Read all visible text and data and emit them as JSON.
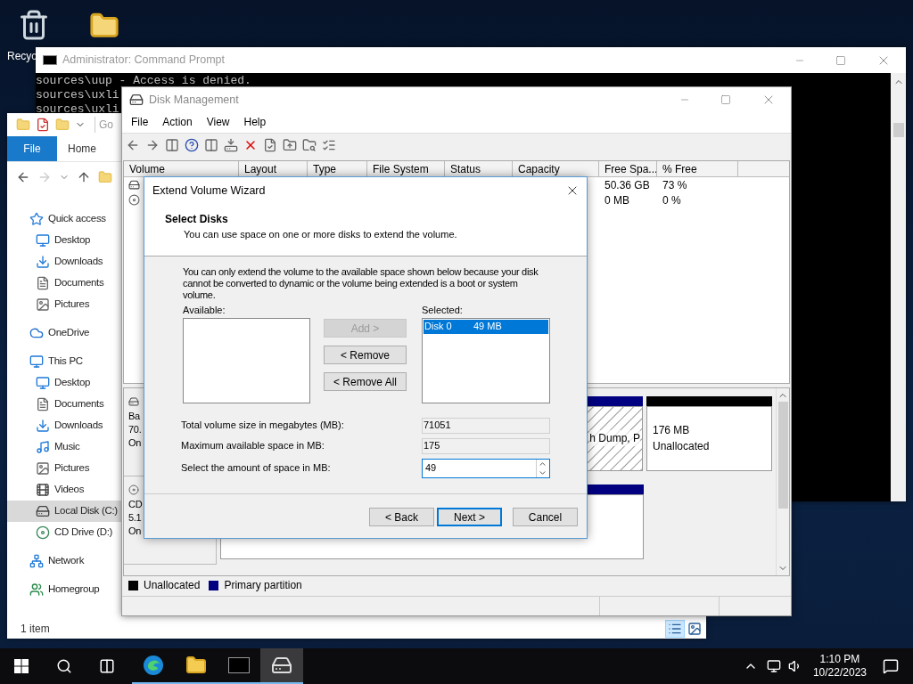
{
  "desktop": {
    "icons": [
      {
        "kind": "recycle",
        "label": "Recyc"
      },
      {
        "kind": "folder"
      }
    ]
  },
  "cmd": {
    "title": "Administrator: Command Prompt",
    "lines": [
      "sources\\uup - Access is denied.",
      "sources\\uxli",
      "sources\\uxli"
    ]
  },
  "explorer": {
    "title_fragment": "Go",
    "ribbon_tabs": [
      {
        "label": "File",
        "selected": true
      },
      {
        "label": "Home",
        "selected": false
      }
    ],
    "nav": [
      {
        "label": "Quick access",
        "kind": "star",
        "selected": false,
        "children": [
          {
            "label": "Desktop",
            "kind": "desktop",
            "selected": false
          },
          {
            "label": "Downloads",
            "kind": "download",
            "selected": false
          },
          {
            "label": "Documents",
            "kind": "document",
            "selected": false
          },
          {
            "label": "Pictures",
            "kind": "picture",
            "selected": false
          }
        ]
      },
      {
        "label": "OneDrive",
        "kind": "cloud",
        "selected": false
      },
      {
        "label": "This PC",
        "kind": "pc",
        "selected": false,
        "children": [
          {
            "label": "Desktop",
            "kind": "desktop",
            "selected": false
          },
          {
            "label": "Documents",
            "kind": "document",
            "selected": false
          },
          {
            "label": "Downloads",
            "kind": "download",
            "selected": false
          },
          {
            "label": "Music",
            "kind": "music",
            "selected": false
          },
          {
            "label": "Pictures",
            "kind": "picture",
            "selected": false
          },
          {
            "label": "Videos",
            "kind": "video",
            "selected": false
          },
          {
            "label": "Local Disk (C:)",
            "kind": "drive",
            "selected": true
          },
          {
            "label": "CD Drive (D:)",
            "kind": "cd",
            "selected": false
          }
        ]
      },
      {
        "label": "Network",
        "kind": "network",
        "selected": false
      },
      {
        "label": "Homegroup",
        "kind": "homegroup",
        "selected": false
      }
    ],
    "status": "1 item",
    "views": [
      {
        "kind": "details",
        "selected": true
      },
      {
        "kind": "thumbnails",
        "selected": false
      }
    ]
  },
  "disk_management": {
    "title": "Disk Management",
    "menu": [
      "File",
      "Action",
      "View",
      "Help"
    ],
    "columns": [
      "Volume",
      "Layout",
      "Type",
      "File System",
      "Status",
      "Capacity",
      "Free Spa...",
      "% Free"
    ],
    "rows": [
      {
        "kind": "disk",
        "free_space": "50.36 GB",
        "percent_free": "73 %"
      },
      {
        "kind": "cd",
        "free_space": "0 MB",
        "percent_free": "0 %"
      }
    ],
    "disks": [
      {
        "kind": "disk",
        "label_lines": [
          "Ba",
          "70.",
          "On"
        ],
        "partitions": [
          {
            "kind": "hatched",
            "text": "h Dump, P"
          },
          {
            "kind": "unallocated",
            "size": "176 MB",
            "status": "Unallocated"
          }
        ]
      },
      {
        "kind": "cd",
        "label_lines": [
          "CD",
          "5.1",
          "On"
        ],
        "partitions": [
          {
            "kind": "primary"
          }
        ]
      }
    ],
    "legend": [
      {
        "label": "Unallocated",
        "color": "#000000"
      },
      {
        "label": "Primary partition",
        "color": "#000080"
      }
    ]
  },
  "wizard": {
    "title": "Extend Volume Wizard",
    "heading": "Select Disks",
    "subheading": "You can use space on one or more disks to extend the volume.",
    "note": "You can only extend the volume to the available space shown below because your disk cannot be converted to dynamic or the volume being extended is a boot or system volume.",
    "available_label": "Available:",
    "selected_label": "Selected:",
    "selected_items": [
      {
        "disk": "Disk 0",
        "size": "49 MB",
        "selected": true
      }
    ],
    "move_buttons": [
      {
        "label": "Add >",
        "disabled": true
      },
      {
        "label": "< Remove",
        "disabled": false
      },
      {
        "label": "< Remove All",
        "disabled": false
      }
    ],
    "fields": [
      {
        "kind": "readonly",
        "label": "Total volume size in megabytes (MB):",
        "value": "71051"
      },
      {
        "kind": "readonly",
        "label": "Maximum available space in MB:",
        "value": "175"
      },
      {
        "kind": "spin",
        "label": "Select the amount of space in MB:",
        "value": "49"
      }
    ],
    "buttons": [
      {
        "label": "< Back",
        "default": false
      },
      {
        "label": "Next >",
        "default": true
      },
      {
        "label": "Cancel",
        "default": false
      }
    ]
  },
  "taskbar": {
    "apps": [
      {
        "kind": "edge",
        "selected": false
      },
      {
        "kind": "explorer",
        "selected": false
      },
      {
        "kind": "cmd",
        "selected": false
      },
      {
        "kind": "diskmgmt",
        "selected": true
      }
    ],
    "time": "1:10 PM",
    "date": "10/22/2023"
  }
}
